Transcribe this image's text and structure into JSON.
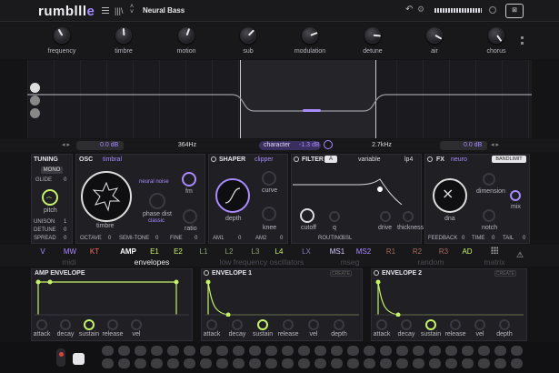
{
  "app": {
    "logo": "rumblll",
    "logo_suffix": "e",
    "preset": "Neural Bass",
    "nav_icon": "menu-icon",
    "browse_icon": "library-icon"
  },
  "macros": [
    {
      "label": "frequency"
    },
    {
      "label": "timbre"
    },
    {
      "label": "motion"
    },
    {
      "label": "sub"
    },
    {
      "label": "modulation"
    },
    {
      "label": "detune"
    },
    {
      "label": "air"
    },
    {
      "label": "chorus"
    }
  ],
  "filterbar": {
    "left_value": "0.0 dB",
    "freq1": "364Hz",
    "character_label": "character",
    "character_value": "-1.3 dB",
    "freq2": "2.7kHz",
    "right_value": "0.0 dB"
  },
  "tuning": {
    "title": "TUNING",
    "mode_btn": "MONO",
    "glide_label": "GLIDE",
    "glide_value": "0",
    "pitch_label": "pitch",
    "unison_label": "UNISON",
    "unison_value": "1",
    "detune_label": "DETUNE",
    "detune_value": "0",
    "spread_label": "SPREAD",
    "spread_value": "0"
  },
  "osc": {
    "title": "OSC",
    "type": "timbral",
    "neural_label": "neural noise",
    "fm_label": "fm",
    "phase_label": "phase dist",
    "phase_value": "classic",
    "timbre_label": "timbre",
    "ratio_label": "ratio",
    "octave_label": "OCTAVE",
    "octave_value": "0",
    "semitone_label": "SEMI-TONE",
    "semitone_value": "0",
    "fine_label": "FINE",
    "fine_value": "0"
  },
  "shaper": {
    "title": "SHAPER",
    "type": "clipper",
    "depth_label": "depth",
    "curve_label": "curve",
    "knee_label": "knee",
    "am1_label": "AM1",
    "am1_value": "0",
    "am2_label": "AM2",
    "am2_value": "0"
  },
  "filter": {
    "title": "FILTER",
    "ab": "A",
    "type": "variable",
    "slope": "lp4",
    "cutoff_label": "cutoff",
    "q_label": "q",
    "drive_label": "drive",
    "thickness_label": "thickness",
    "routing_label": "ROUTING",
    "routing_value": "SSL"
  },
  "fx": {
    "title": "FX",
    "type": "neuro",
    "bandlimit": "BANDLIMIT",
    "dna_label": "dna",
    "dimension_label": "dimension",
    "notch_label": "notch",
    "mix_label": "mix",
    "feedback_label": "FEEDBACK",
    "feedback_value": "0",
    "time_label": "TIME",
    "time_value": "0",
    "tail_label": "TAIL",
    "tail_value": "0"
  },
  "tabs": [
    {
      "short": "V",
      "group": "midi"
    },
    {
      "short": "MW",
      "group": ""
    },
    {
      "short": "KT",
      "group": ""
    },
    {
      "short": "AMP",
      "group": ""
    },
    {
      "short": "E1",
      "group": "envelopes"
    },
    {
      "short": "E2",
      "group": ""
    },
    {
      "short": "L1",
      "group": ""
    },
    {
      "short": "L2",
      "group": "low frequency oscillators"
    },
    {
      "short": "L3",
      "group": ""
    },
    {
      "short": "L4",
      "group": ""
    },
    {
      "short": "LX",
      "group": ""
    },
    {
      "short": "MS1",
      "group": "mseg"
    },
    {
      "short": "MS2",
      "group": ""
    },
    {
      "short": "R1",
      "group": ""
    },
    {
      "short": "R2",
      "group": "random"
    },
    {
      "short": "R3",
      "group": ""
    },
    {
      "short": "AD",
      "group": ""
    },
    {
      "short": "",
      "group": "matrix"
    }
  ],
  "envelopes": [
    {
      "title": "AMP ENVELOPE",
      "create": "",
      "knobs": [
        "attack",
        "decay",
        "sustain",
        "release",
        "vel"
      ]
    },
    {
      "title": "ENVELOPE 1",
      "create": "CREATE",
      "knobs": [
        "attack",
        "decay",
        "sustain",
        "release",
        "vel",
        "depth"
      ]
    },
    {
      "title": "ENVELOPE 2",
      "create": "CREATE",
      "knobs": [
        "attack",
        "decay",
        "sustain",
        "release",
        "vel",
        "depth"
      ]
    }
  ],
  "colors": {
    "accent": "#a98bff",
    "lime": "#c6f26a",
    "bg": "#141416",
    "panel": "#1f1f24"
  }
}
